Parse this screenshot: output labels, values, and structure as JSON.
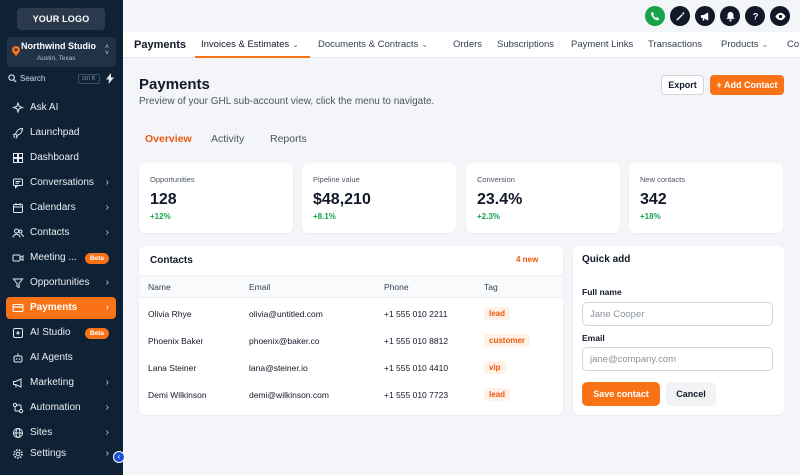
{
  "sidebar": {
    "logo": "YOUR LOGO",
    "account_name": "Northwind Studio",
    "account_location": "Austin, Texas",
    "search_placeholder": "Search",
    "search_shortcut": "ctrl K",
    "items": [
      {
        "label": "Ask AI",
        "icon": "sparkle-icon"
      },
      {
        "label": "Launchpad",
        "icon": "rocket-icon"
      },
      {
        "label": "Dashboard",
        "icon": "dashboard-icon"
      },
      {
        "label": "Conversations",
        "icon": "chat-icon"
      },
      {
        "label": "Calendars",
        "icon": "calendar-icon"
      },
      {
        "label": "Contacts",
        "icon": "contacts-icon"
      },
      {
        "label": "Meeting ...",
        "icon": "video-icon",
        "badge": "Beta"
      },
      {
        "label": "Opportunities",
        "icon": "funnel-icon"
      },
      {
        "label": "Payments",
        "icon": "card-icon",
        "active": true
      },
      {
        "label": "AI Studio",
        "icon": "ai-studio-icon",
        "badge": "Beta"
      },
      {
        "label": "AI Agents",
        "icon": "robot-icon"
      },
      {
        "label": "Marketing",
        "icon": "megaphone-icon"
      },
      {
        "label": "Automation",
        "icon": "automation-icon"
      },
      {
        "label": "Sites",
        "icon": "globe-icon"
      },
      {
        "label": "Settings",
        "icon": "gear-icon"
      }
    ]
  },
  "topbar": {
    "title": "Payments",
    "tabs": [
      {
        "label": "Invoices & Estimates",
        "dropdown": true
      },
      {
        "label": "Documents & Contracts",
        "dropdown": true
      },
      {
        "label": "Orders"
      },
      {
        "label": "Subscriptions"
      },
      {
        "label": "Payment Links"
      },
      {
        "label": "Transactions"
      },
      {
        "label": "Products",
        "dropdown": true
      },
      {
        "label": "Co"
      }
    ]
  },
  "page": {
    "title": "Payments",
    "subtitle": "Preview of your GHL sub-account view, click the menu to navigate.",
    "export_label": "Export",
    "add_contact_label": "+ Add Contact",
    "subtabs": [
      "Overview",
      "Activity",
      "Reports"
    ]
  },
  "stats": [
    {
      "label": "Opportunities",
      "value": "128",
      "delta": "+12%"
    },
    {
      "label": "Pipeline value",
      "value": "$48,210",
      "delta": "+8.1%"
    },
    {
      "label": "Conversion",
      "value": "23.4%",
      "delta": "+2.3%"
    },
    {
      "label": "New contacts",
      "value": "342",
      "delta": "+18%"
    }
  ],
  "contacts": {
    "title": "Contacts",
    "new_count": "4 new",
    "columns": [
      "Name",
      "Email",
      "Phone",
      "Tag"
    ],
    "rows": [
      {
        "name": "Olivia Rhye",
        "email": "olivia@untitled.com",
        "phone": "+1 555 010 2211",
        "tag": "lead"
      },
      {
        "name": "Phoenix Baker",
        "email": "phoenix@baker.co",
        "phone": "+1 555 010 8812",
        "tag": "customer"
      },
      {
        "name": "Lana Steiner",
        "email": "lana@steiner.io",
        "phone": "+1 555 010 4410",
        "tag": "vip"
      },
      {
        "name": "Demi Wilkinson",
        "email": "demi@wilkinson.com",
        "phone": "+1 555 010 7723",
        "tag": "lead"
      }
    ]
  },
  "quick_add": {
    "title": "Quick add",
    "fullname_label": "Full name",
    "fullname_placeholder": "Jane Cooper",
    "email_label": "Email",
    "email_placeholder": "jane@company.com",
    "save_label": "Save contact",
    "cancel_label": "Cancel"
  },
  "colors": {
    "accent": "#f97316",
    "sidebar": "#0f2235",
    "positive": "#16a34a"
  }
}
